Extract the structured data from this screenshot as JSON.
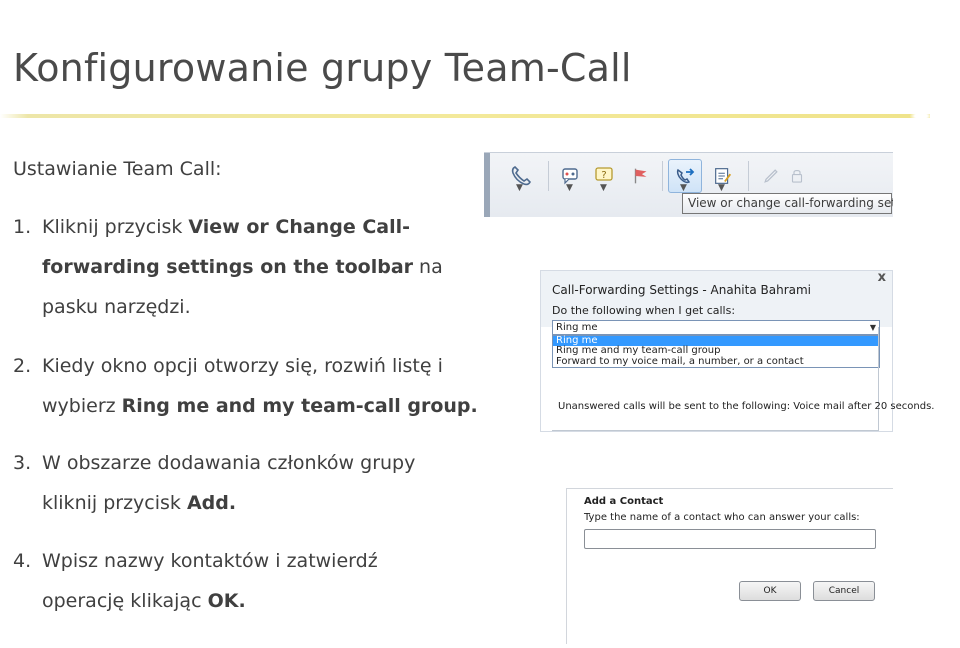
{
  "slide": {
    "title": "Konfigurowanie grupy Team-Call",
    "subtitle": "Ustawianie Team Call:"
  },
  "steps": [
    {
      "num": "1.",
      "pre": "Kliknij przycisk ",
      "bold1": "View or Change Call-",
      "bold2": "forwarding settings on the toolbar",
      "post": " na",
      "line3": "pasku narzędzi."
    },
    {
      "num": "2.",
      "line1": "Kiedy okno opcji otworzy się, rozwiń listę i",
      "pre": "wybierz ",
      "bold": "Ring me and my team-call group."
    },
    {
      "num": "3.",
      "line1": "W obszarze dodawania członków grupy",
      "pre": "kliknij przycisk ",
      "bold": "Add."
    },
    {
      "num": "4.",
      "line1": "Wpisz nazwy kontaktów i zatwierdź",
      "pre": "operację klikając ",
      "bold": "OK."
    }
  ],
  "toolbar": {
    "tooltip": "View or change call-forwarding settings",
    "icons": [
      "phone-icon",
      "conference-icon",
      "chat-question-icon",
      "flag-icon",
      "call-forward-icon",
      "notes-icon",
      "pen-icon",
      "lock-icon"
    ]
  },
  "cf_dialog": {
    "title": "Call-Forwarding Settings - Anahita Bahrami",
    "label": "Do the following when I get calls:",
    "selected": "Ring me",
    "options": [
      "Ring me",
      "Ring me and my team-call group",
      "Forward to my voice mail, a number, or a contact"
    ],
    "unanswered": "Unanswered calls will be sent to the following: Voice mail after 20 seconds.",
    "close": "x"
  },
  "ac_dialog": {
    "title": "Add a Contact",
    "label": "Type the name of a contact who can answer your calls:",
    "input_value": "",
    "ok": "OK",
    "cancel": "Cancel"
  }
}
